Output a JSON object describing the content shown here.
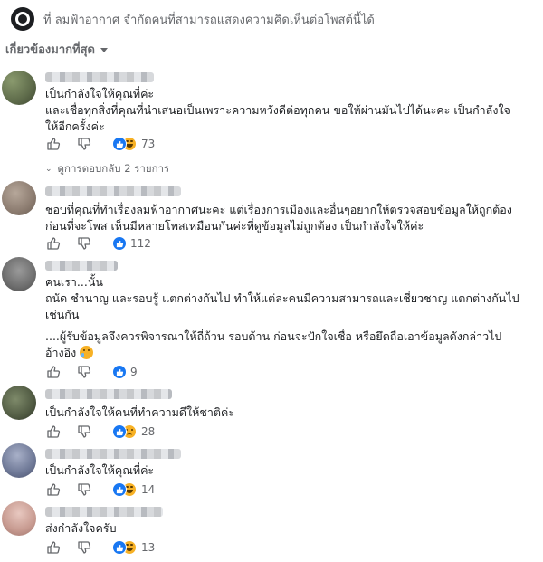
{
  "notice": "ที่ ลมฟ้าอากาศ จำกัดคนที่สามารถแสดงความคิดเห็นต่อโพสต์นี้ได้",
  "sort_label": "เกี่ยวข้องมากที่สุด",
  "colors": {
    "like_blue": "#1877f2",
    "haha_yellow": "#f7b125",
    "muted_text": "#65676b"
  },
  "comments": [
    {
      "lines": [
        "เป็นกำลังใจให้คุณที่ค่ะ",
        "และเชื่อทุกสิ่งที่คุณที่นำเสนอเป็นเพราะความหวังดีต่อทุกคน ขอให้ผ่านมันไปได้นะคะ เป็นกำลังใจ",
        "ให้อีกครั้งค่ะ"
      ],
      "reactions": [
        "like-icon",
        "haha-icon"
      ],
      "reaction_count": "73",
      "replies_label": "ดูการตอบกลับ 2 รายการ"
    },
    {
      "lines": [
        "ชอบที่คุณที่ทำเรื่องลมฟ้าอากาศนะคะ แต่เรื่องการเมืองและอื่นๆอยากให้ตรวจสอบข้อมูลให้ถูกต้อง",
        "ก่อนที่จะโพส เห็นมีหลายโพสเหมือนกันค่ะที่ดูข้อมูลไม่ถูกต้อง เป็นกำลังใจให้ค่ะ"
      ],
      "reactions": [
        "like-icon"
      ],
      "reaction_count": "112"
    },
    {
      "lines": [
        "คนเรา...นั้น",
        "ถนัด ชำนาญ และรอบรู้ แตกต่างกันไป ทำให้แต่ละคนมีความสามารถและเชี่ยวชาญ แตกต่างกันไป",
        "เช่นกัน",
        "",
        "....ผู้รับข้อมูลจึงควรพิจารณาให้ถี่ถ้วน รอบด้าน ก่อนจะปักใจเชื่อ หรือยึดถือเอาข้อมูลดังกล่าวไป",
        "อ้างอิง"
      ],
      "inline_emoji": "sad-sweat-emoji",
      "reactions": [
        "like-icon"
      ],
      "reaction_count": "9"
    },
    {
      "lines": [
        "เป็นกำลังใจให้คนที่ทำความดีให้ชาติค่ะ"
      ],
      "reactions": [
        "like-icon",
        "sad-icon"
      ],
      "reaction_count": "28"
    },
    {
      "lines": [
        "เป็นกำลังใจให้คุณที่ค่ะ"
      ],
      "reactions": [
        "like-icon",
        "haha-icon"
      ],
      "reaction_count": "14"
    },
    {
      "lines": [
        "ส่งกำลังใจครับ"
      ],
      "reactions": [
        "like-icon",
        "haha-icon"
      ],
      "reaction_count": "13"
    }
  ]
}
